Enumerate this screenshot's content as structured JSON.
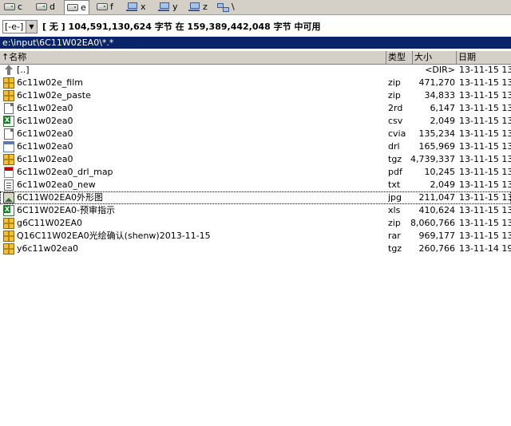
{
  "drives": [
    {
      "letter": "c",
      "icon": "drive-icon",
      "active": false
    },
    {
      "letter": "d",
      "icon": "drive-icon",
      "active": false
    },
    {
      "letter": "e",
      "icon": "drive-icon",
      "active": true
    },
    {
      "letter": "f",
      "icon": "drive-icon",
      "active": false
    },
    {
      "letter": "x",
      "icon": "network-drive-icon",
      "active": false
    },
    {
      "letter": "y",
      "icon": "network-drive-icon",
      "active": false
    },
    {
      "letter": "z",
      "icon": "network-drive-icon",
      "active": false
    },
    {
      "letter": "\\",
      "icon": "network-root-icon",
      "active": false
    }
  ],
  "drive_select": {
    "value": "[-e-]"
  },
  "disk_info": "[ 无 ]  104,591,130,624 字节 在 159,389,442,048 字节 中可用",
  "path": "e:\\input\\6C11W02EA0\\*.*",
  "columns": {
    "name": "↑名称",
    "ext": "类型",
    "size": "大小",
    "date": "日期"
  },
  "files": [
    {
      "name": "[..]",
      "ext": "",
      "size": "<DIR>",
      "date": "13-11-15 13",
      "icon": "up-folder-icon"
    },
    {
      "name": "6c11w02e_film",
      "ext": "zip",
      "size": "471,270",
      "date": "13-11-15 13",
      "icon": "archive-icon"
    },
    {
      "name": "6c11w02e_paste",
      "ext": "zip",
      "size": "34,833",
      "date": "13-11-15 13",
      "icon": "archive-icon"
    },
    {
      "name": "6c11w02ea0",
      "ext": "2rd",
      "size": "6,147",
      "date": "13-11-15 13",
      "icon": "file-icon"
    },
    {
      "name": "6c11w02ea0",
      "ext": "csv",
      "size": "2,049",
      "date": "13-11-15 13",
      "icon": "spreadsheet-icon"
    },
    {
      "name": "6c11w02ea0",
      "ext": "cvia",
      "size": "135,234",
      "date": "13-11-15 13",
      "icon": "file-icon"
    },
    {
      "name": "6c11w02ea0",
      "ext": "drl",
      "size": "165,969",
      "date": "13-11-15 13",
      "icon": "window-file-icon"
    },
    {
      "name": "6c11w02ea0",
      "ext": "tgz",
      "size": "4,739,337",
      "date": "13-11-15 13",
      "icon": "archive-icon"
    },
    {
      "name": "6c11w02ea0_drl_map",
      "ext": "pdf",
      "size": "10,245",
      "date": "13-11-15 13",
      "icon": "pdf-icon"
    },
    {
      "name": "6c11w02ea0_new",
      "ext": "txt",
      "size": "2,049",
      "date": "13-11-15 13",
      "icon": "text-file-icon"
    },
    {
      "name": "6C11W02EA0外形图",
      "ext": "jpg",
      "size": "211,047",
      "date": "13-11-15 13",
      "icon": "image-icon"
    },
    {
      "name": "6C11W02EA0-预审指示",
      "ext": "xls",
      "size": "410,624",
      "date": "13-11-15 13",
      "icon": "spreadsheet-icon"
    },
    {
      "name": "g6C11W02EA0",
      "ext": "zip",
      "size": "8,060,766",
      "date": "13-11-15 13",
      "icon": "archive-icon"
    },
    {
      "name": "Q16C11W02EA0光绘确认(shenw)2013-11-15",
      "ext": "rar",
      "size": "969,177",
      "date": "13-11-15 13",
      "icon": "archive-icon"
    },
    {
      "name": "y6c11w02ea0",
      "ext": "tgz",
      "size": "260,766",
      "date": "13-11-14 19",
      "icon": "archive-icon"
    }
  ],
  "focused_row": 10
}
